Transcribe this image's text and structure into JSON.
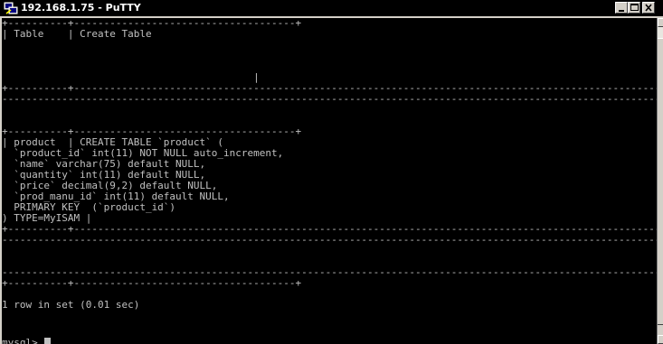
{
  "window": {
    "title": "192.168.1.75 - PuTTY",
    "icon": "putty-terminal-icon",
    "buttons": [
      "minimize",
      "maximize",
      "close"
    ]
  },
  "terminal": {
    "output": [
      "+----------+-------------------------------------+",
      "| Table    | Create Table",
      "",
      "",
      "",
      "                                          |",
      "+----------+------------------------------------------------------------------------------------------------------",
      "------------------------------------------------------------------------------------------------------------------",
      "",
      "",
      "+----------+-------------------------------------+",
      "| product  | CREATE TABLE `product` (",
      "  `product_id` int(11) NOT NULL auto_increment,",
      "  `name` varchar(75) default NULL,",
      "  `quantity` int(11) default NULL,",
      "  `price` decimal(9,2) default NULL,",
      "  `prod_manu_id` int(11) default NULL,",
      "  PRIMARY KEY  (`product_id`)",
      ") TYPE=MyISAM |",
      "+----------+------------------------------------------------------------------------------------------------------",
      "------------------------------------------------------------------------------------------------------------------",
      "",
      "",
      "------------------------------------------------------------------------------------------------------------------",
      "+----------+-------------------------------------+",
      "",
      "1 row in set (0.01 sec)",
      "",
      ""
    ],
    "prompt": "mysql> ",
    "colors": {
      "background": "#000000",
      "foreground": "#c0c0c0"
    }
  }
}
